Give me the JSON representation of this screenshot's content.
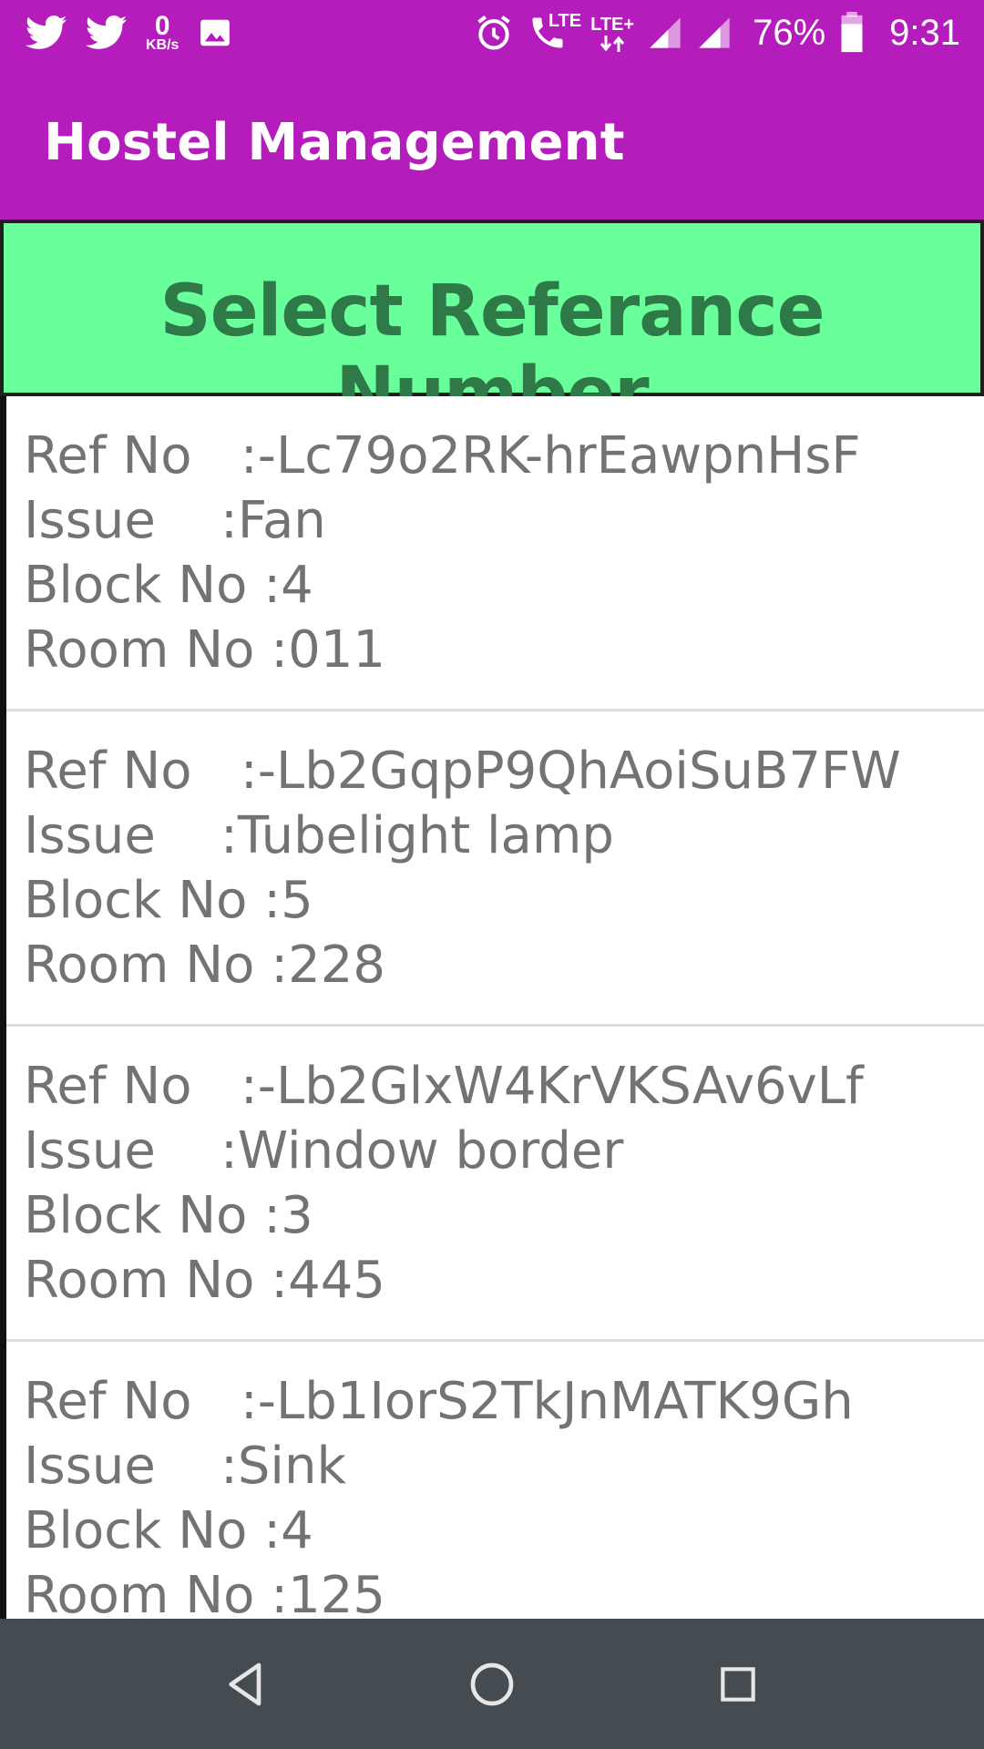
{
  "status_bar": {
    "left_icons": [
      "twitter-icon",
      "twitter-icon",
      "data-speed",
      "image-icon"
    ],
    "data_speed_value": "0",
    "data_speed_unit": "KB/s",
    "right_icons": [
      "alarm-icon",
      "volte-call-icon",
      "lte-plus-icon",
      "signal-icon",
      "signal-icon",
      "battery-icon"
    ],
    "lte_label": "LTE",
    "lte_plus_label": "LTE+",
    "battery": "76%",
    "time": "9:31"
  },
  "app_bar": {
    "title": "Hostel Management"
  },
  "header": {
    "title": "Select Referance Number"
  },
  "list": {
    "items": [
      {
        "ref": "Ref No   :-Lc79o2RK-hrEawpnHsF",
        "issue": "Issue    :Fan",
        "block": "Block No :4",
        "room": "Room No :011"
      },
      {
        "ref": "Ref No   :-Lb2GqpP9QhAoiSuB7FW",
        "issue": "Issue    :Tubelight lamp",
        "block": "Block No :5",
        "room": "Room No :228"
      },
      {
        "ref": "Ref No   :-Lb2GlxW4KrVKSAv6vLf",
        "issue": "Issue    :Window border",
        "block": "Block No :3",
        "room": "Room No :445"
      },
      {
        "ref": "Ref No   :-Lb1IorS2TkJnMATK9Gh",
        "issue": "Issue    :Sink",
        "block": "Block No :4",
        "room": "Room No :125"
      }
    ]
  },
  "nav_bar": {
    "buttons": [
      "back-icon",
      "home-icon",
      "recents-icon"
    ]
  },
  "colors": {
    "primary": "#b41cbb",
    "header_bg": "#69ff9a",
    "header_text": "#2f7848",
    "item_text": "#737373",
    "nav_bar": "#444b51"
  }
}
